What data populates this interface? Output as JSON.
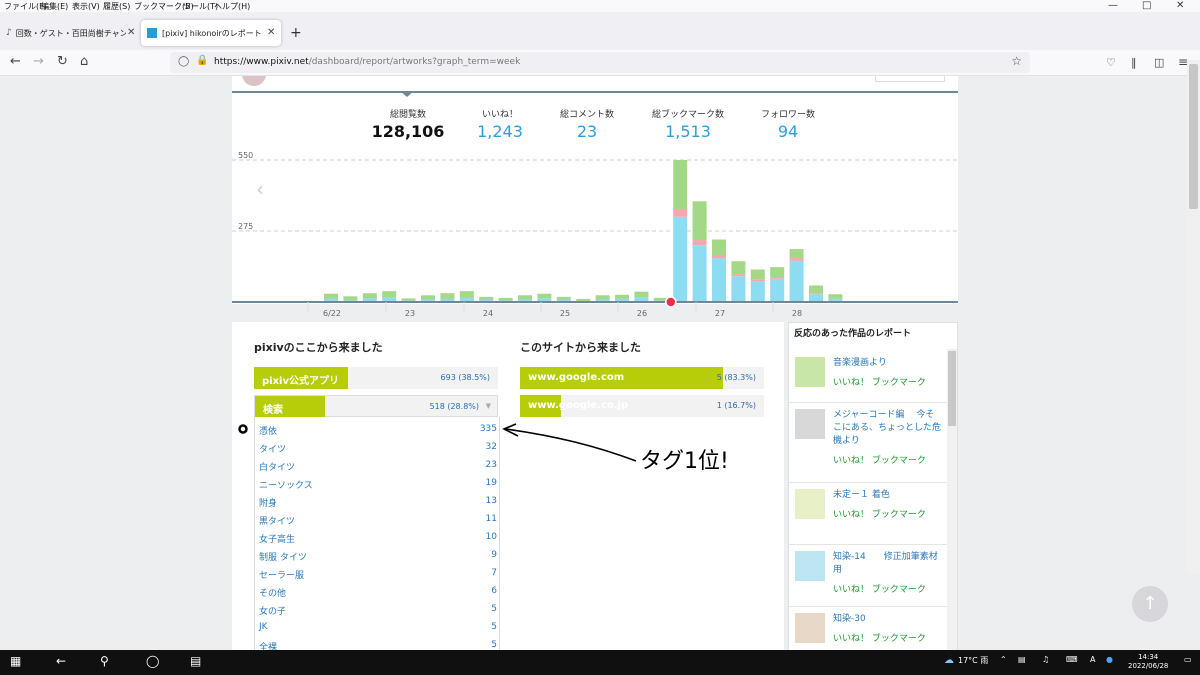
{
  "browser": {
    "menu": [
      "ファイル(F)",
      "編集(E)",
      "表示(V)",
      "履歴(S)",
      "ブックマーク(B)",
      "ツール(T)",
      "ヘルプ(H)"
    ],
    "tabs": [
      {
        "label": "回数・ゲスト・百田尚樹チャンネル:ホ",
        "active": false
      },
      {
        "label": "[pixiv] hikonoirのレポート",
        "active": true
      }
    ],
    "new_tab": "+",
    "url_host": "https://www.pixiv.net",
    "url_path": "/dashboard/report/artworks?graph_term=week"
  },
  "stats": [
    {
      "label": "総閲覧数",
      "value": "128,106"
    },
    {
      "label": "いいね！",
      "value": "1,243"
    },
    {
      "label": "総コメント数",
      "value": "23"
    },
    {
      "label": "総ブックマーク数",
      "value": "1,513"
    },
    {
      "label": "フォロワー数",
      "value": "94"
    }
  ],
  "chart_data": {
    "type": "bar",
    "stacked": true,
    "yticks": [
      "550",
      "275"
    ],
    "ylim": [
      0,
      550
    ],
    "xticks": [
      "6/22",
      "23",
      "24",
      "25",
      "26",
      "27",
      "28"
    ],
    "colors": {
      "views": "#8ddcf2",
      "likes": "#f6a6ad",
      "bookmarks": "#a3d886",
      "accent": "#ef2f4c"
    },
    "series_values": [
      [
        12,
        0,
        20
      ],
      [
        8,
        0,
        14
      ],
      [
        14,
        0,
        20
      ],
      [
        18,
        0,
        24
      ],
      [
        6,
        0,
        8
      ],
      [
        10,
        0,
        16
      ],
      [
        12,
        0,
        22
      ],
      [
        16,
        0,
        26
      ],
      [
        8,
        0,
        12
      ],
      [
        6,
        0,
        10
      ],
      [
        10,
        0,
        16
      ],
      [
        14,
        0,
        18
      ],
      [
        8,
        0,
        12
      ],
      [
        4,
        0,
        8
      ],
      [
        10,
        0,
        16
      ],
      [
        12,
        0,
        16
      ],
      [
        18,
        0,
        22
      ],
      [
        6,
        0,
        10
      ],
      [
        330,
        30,
        190
      ],
      [
        220,
        20,
        150
      ],
      [
        170,
        12,
        60
      ],
      [
        100,
        8,
        50
      ],
      [
        80,
        6,
        40
      ],
      [
        90,
        5,
        40
      ],
      [
        160,
        10,
        35
      ],
      [
        30,
        4,
        30
      ],
      [
        12,
        0,
        18
      ]
    ]
  },
  "referrers_pixiv": {
    "title": "pixivのここから来ました",
    "items": [
      {
        "name": "pixiv公式アプリ",
        "count": "693 (38.5%)",
        "pct": 38.5
      },
      {
        "name": "検索",
        "count": "518 (28.8%)",
        "pct": 28.8
      }
    ],
    "tags": [
      {
        "t": "憑依",
        "n": "335"
      },
      {
        "t": "タイツ",
        "n": "32"
      },
      {
        "t": "白タイツ",
        "n": "23"
      },
      {
        "t": "ニーソックス",
        "n": "19"
      },
      {
        "t": "附身",
        "n": "13"
      },
      {
        "t": "黒タイツ",
        "n": "11"
      },
      {
        "t": "女子高生",
        "n": "10"
      },
      {
        "t": "制服 タイツ",
        "n": "9"
      },
      {
        "t": "セーラー服",
        "n": "7"
      },
      {
        "t": "その他",
        "n": "6"
      },
      {
        "t": "女の子",
        "n": "5"
      },
      {
        "t": "JK",
        "n": "5"
      },
      {
        "t": "全裸",
        "n": "5"
      }
    ]
  },
  "referrers_site": {
    "title": "このサイトから来ました",
    "items": [
      {
        "name": "www.google.com",
        "count": "5 (83.3%)",
        "pct": 83.3
      },
      {
        "name": "www.google.co.jp",
        "count": "1 (16.7%)",
        "pct": 16.7
      }
    ]
  },
  "annotation": {
    "text": "タグ1位!"
  },
  "sidebar": {
    "title": "反応のあった作品のレポート",
    "works": [
      {
        "title": "音楽漫画より",
        "likes": "いいね！ ブックマーク"
      },
      {
        "title": "メジャーコード編　 今そこにある、ちょっとした危機より",
        "likes": "いいね！ ブックマーク"
      },
      {
        "title": "未定ー１ 着色",
        "likes": "いいね！ ブックマーク"
      },
      {
        "title": "知染-14　　修正加筆素材用",
        "likes": "いいね！ ブックマーク"
      },
      {
        "title": "知染-30",
        "likes": "いいね！ ブックマーク"
      }
    ]
  },
  "taskbar": {
    "weather": "17°C 雨",
    "ime": "A",
    "time": "14:34",
    "date": "2022/06/28"
  }
}
